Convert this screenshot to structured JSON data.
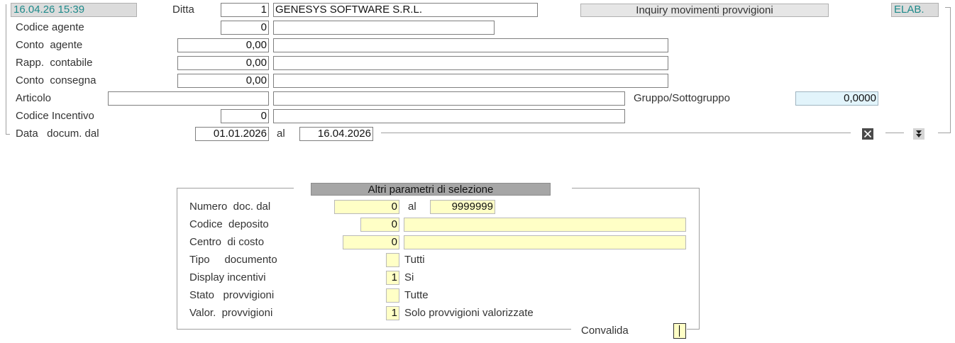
{
  "header": {
    "datetime": "16.04.26 15:39",
    "ditta_label": "Ditta",
    "ditta_code": "1",
    "ditta_name": "GENESYS SOFTWARE S.R.L.",
    "program_title": "Inquiry movimenti provvigioni",
    "status": "ELAB."
  },
  "main_form": {
    "codice_agente": {
      "label": "Codice agente",
      "value": "0",
      "desc": ""
    },
    "conto_agente": {
      "label": "Conto  agente",
      "value": "0,00",
      "desc": ""
    },
    "rapp_contabile": {
      "label": "Rapp.  contabile",
      "value": "0,00",
      "desc": ""
    },
    "conto_consegna": {
      "label": "Conto  consegna",
      "value": "0,00",
      "desc": ""
    },
    "articolo": {
      "label": "Articolo",
      "value": "",
      "desc": ""
    },
    "gruppo": {
      "label": "Gruppo/Sottogruppo",
      "value": "0,0000"
    },
    "codice_incentivo": {
      "label": "Codice Incentivo",
      "value": "0",
      "desc": ""
    },
    "data_docum": {
      "label": "Data   docum. dal",
      "from": "01.01.2026",
      "al_label": "al",
      "to": "16.04.2026"
    }
  },
  "panel": {
    "title": "Altri parametri di selezione",
    "numero_doc": {
      "label": "Numero  doc. dal",
      "from": "0",
      "al_label": "al",
      "to": "9999999"
    },
    "codice_deposito": {
      "label": "Codice  deposito",
      "value": "0",
      "desc": ""
    },
    "centro_costo": {
      "label": "Centro  di costo",
      "value": "0",
      "desc": ""
    },
    "tipo_documento": {
      "label": "Tipo     documento",
      "value": "",
      "desc": "Tutti"
    },
    "display_incentivi": {
      "label": "Display incentivi",
      "value": "1",
      "desc": "Si"
    },
    "stato_provvigioni": {
      "label": "Stato   provvigioni",
      "value": "",
      "desc": "Tutte"
    },
    "valor_provvigioni": {
      "label": "Valor.  provvigioni",
      "value": "1",
      "desc": "Solo provvigioni valorizzate"
    },
    "convalida_label": "Convalida"
  },
  "icons": {
    "close": "close-icon",
    "expand": "double-chevron-down-icon"
  },
  "colors": {
    "teal_text": "#1e8a8a",
    "yellow_field": "#ffffc6",
    "cyan_field": "#e2f4fb",
    "panel_title_bg": "#a6a6a6"
  }
}
